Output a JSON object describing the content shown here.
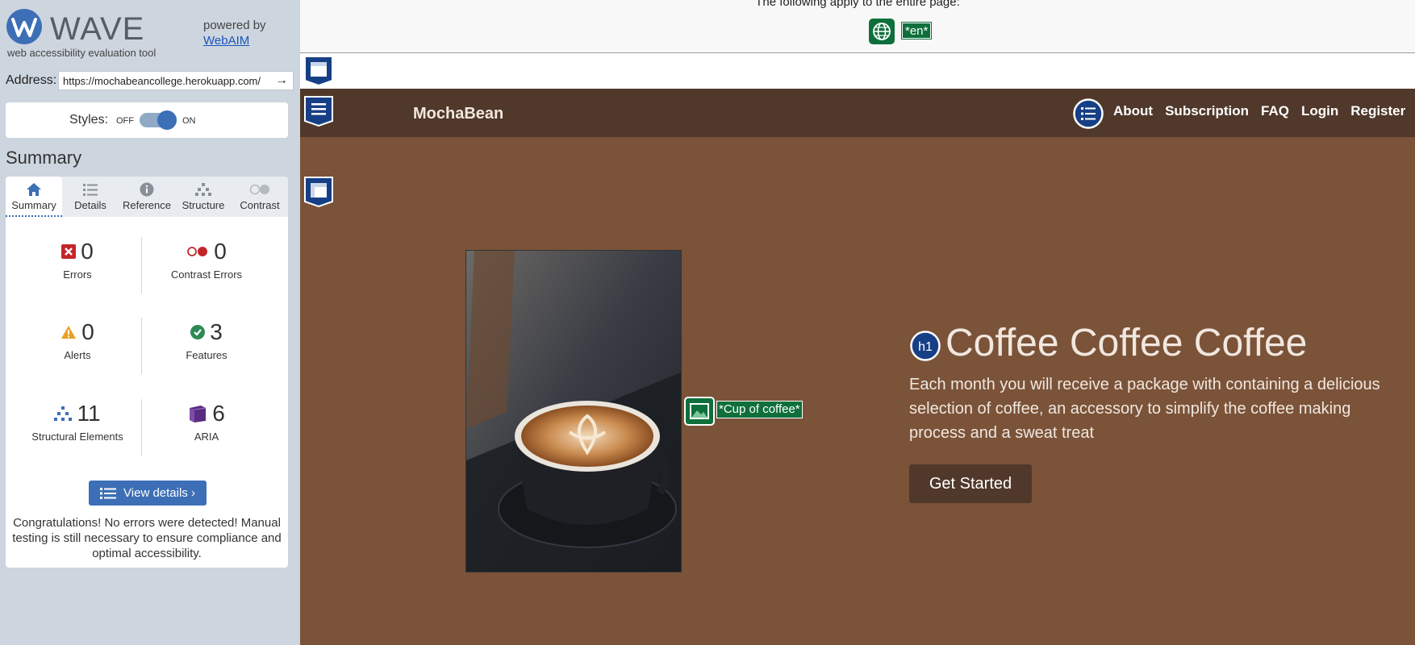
{
  "wave": {
    "logo_word": "WAVE",
    "tagline": "web accessibility evaluation tool",
    "powered_by": "powered by",
    "webaim_link": "WebAIM",
    "address_label": "Address:",
    "address_value": "https://mochabeancollege.herokuapp.com/",
    "styles_label": "Styles:",
    "styles_off": "OFF",
    "styles_on": "ON",
    "summary_title": "Summary",
    "tabs": [
      {
        "label": "Summary",
        "icon": "home-icon"
      },
      {
        "label": "Details",
        "icon": "list-icon"
      },
      {
        "label": "Reference",
        "icon": "info-icon"
      },
      {
        "label": "Structure",
        "icon": "hierarchy-icon"
      },
      {
        "label": "Contrast",
        "icon": "contrast-icon"
      }
    ],
    "stats": {
      "errors": {
        "count": "0",
        "label": "Errors"
      },
      "contrast_errors": {
        "count": "0",
        "label": "Contrast Errors"
      },
      "alerts": {
        "count": "0",
        "label": "Alerts"
      },
      "features": {
        "count": "3",
        "label": "Features"
      },
      "structural": {
        "count": "11",
        "label": "Structural Elements"
      },
      "aria": {
        "count": "6",
        "label": "ARIA"
      }
    },
    "view_details": "View details ›",
    "congrats": "Congratulations! No errors were detected! Manual testing is still necessary to ensure compliance and optimal accessibility."
  },
  "page": {
    "entire_page_note": "The following apply to the entire page:",
    "lang_badge": "*en*",
    "brand": "MochaBean",
    "nav": [
      "About",
      "Subscription",
      "FAQ",
      "Login",
      "Register"
    ],
    "image_alt_badge": "*Cup of coffee*",
    "h1_badge": "h1",
    "hero_title": "Coffee Coffee Coffee",
    "hero_text": "Each month you will receive a package with containing a delicious selection of coffee, an accessory to simplify the coffee making process and a sweat treat",
    "cta": "Get Started"
  },
  "colors": {
    "wave_blue": "#3c6fb6",
    "feature_green": "#0f6f3b",
    "nav_brown": "#50382a",
    "hero_brown": "#7a5339",
    "hero_text": "#f1e7df"
  }
}
